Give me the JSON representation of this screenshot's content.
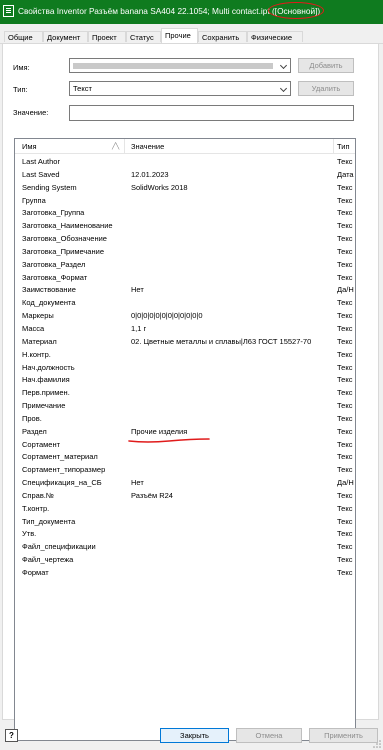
{
  "window": {
    "title_prefix": "Свойства Inventor Разъём banana  SA404 22.1054; Multi contact.ipt ",
    "title_highlight": "([Основной])",
    "accent": "#0f7b1f",
    "annotation_color": "#e01b1b"
  },
  "tabs": [
    {
      "label": "Общие"
    },
    {
      "label": "Документ"
    },
    {
      "label": "Проект"
    },
    {
      "label": "Статус"
    },
    {
      "label": "Прочие"
    },
    {
      "label": "Сохранить"
    },
    {
      "label": "Физические"
    }
  ],
  "active_tab": "Прочие",
  "form": {
    "name_label": "Имя:",
    "name_value": "",
    "add_button": "Добавить",
    "type_label": "Тип:",
    "type_value": "Текст",
    "delete_button": "Удалить",
    "value_label": "Значение:",
    "value_value": ""
  },
  "table": {
    "columns": [
      "Имя",
      "Значение",
      "Тип"
    ],
    "rows": [
      {
        "name": "Last Author",
        "value": "",
        "type": "Текс"
      },
      {
        "name": "Last Saved",
        "value": "12.01.2023",
        "type": "Дата"
      },
      {
        "name": "Sending System",
        "value": "SolidWorks 2018",
        "type": "Текс"
      },
      {
        "name": "Группа",
        "value": "",
        "type": "Текс"
      },
      {
        "name": "Заготовка_Группа",
        "value": "",
        "type": "Текс"
      },
      {
        "name": "Заготовка_Наименование",
        "value": "",
        "type": "Текс"
      },
      {
        "name": "Заготовка_Обозначение",
        "value": "",
        "type": "Текс"
      },
      {
        "name": "Заготовка_Примечание",
        "value": "",
        "type": "Текс"
      },
      {
        "name": "Заготовка_Раздел",
        "value": "",
        "type": "Текс"
      },
      {
        "name": "Заготовка_Формат",
        "value": "",
        "type": "Текс"
      },
      {
        "name": "Заимствование",
        "value": "Нет",
        "type": "Да/Н"
      },
      {
        "name": "Код_документа",
        "value": "",
        "type": "Текс"
      },
      {
        "name": "Маркеры",
        "value": "0|0|0|0|0|0|0|0|0|0|0|0",
        "type": "Текс"
      },
      {
        "name": "Масса",
        "value": "1,1 г",
        "type": "Текс"
      },
      {
        "name": "Материал",
        "value": "02. Цветные металлы и сплавы|Л63 ГОСТ 15527-70",
        "type": "Текс"
      },
      {
        "name": "Н.контр.",
        "value": "",
        "type": "Текс"
      },
      {
        "name": "Нач.должность",
        "value": "",
        "type": "Текс"
      },
      {
        "name": "Нач.фамилия",
        "value": "",
        "type": "Текс"
      },
      {
        "name": "Перв.примен.",
        "value": "",
        "type": "Текс"
      },
      {
        "name": "Примечание",
        "value": "",
        "type": "Текс"
      },
      {
        "name": "Пров.",
        "value": "",
        "type": "Текс"
      },
      {
        "name": "Раздел",
        "value": "Прочие изделия",
        "type": "Текс",
        "marked": true
      },
      {
        "name": "Сортамент",
        "value": "",
        "type": "Текс"
      },
      {
        "name": "Сортамент_материал",
        "value": "",
        "type": "Текс"
      },
      {
        "name": "Сортамент_типоразмер",
        "value": "",
        "type": "Текс"
      },
      {
        "name": "Спецификация_на_СБ",
        "value": "Нет",
        "type": "Да/Н"
      },
      {
        "name": "Справ.№",
        "value": "Разъём R24",
        "type": "Текс"
      },
      {
        "name": "Т.контр.",
        "value": "",
        "type": "Текс"
      },
      {
        "name": "Тип_документа",
        "value": "",
        "type": "Текс"
      },
      {
        "name": "Утв.",
        "value": "",
        "type": "Текс"
      },
      {
        "name": "Файл_спецификации",
        "value": "",
        "type": "Текс"
      },
      {
        "name": "Файл_чертежа",
        "value": "",
        "type": "Текс"
      },
      {
        "name": "Формат",
        "value": "",
        "type": "Текс"
      }
    ]
  },
  "footer": {
    "help_label": "?",
    "close_button": "Закрыть",
    "cancel_button": "Отмена",
    "apply_button": "Применить"
  }
}
